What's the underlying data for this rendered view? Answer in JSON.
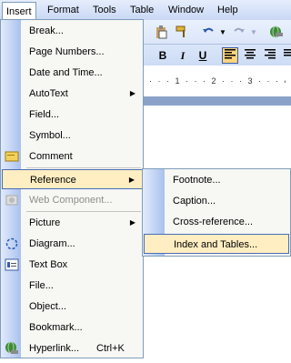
{
  "menubar": {
    "items": [
      {
        "label": "Insert",
        "active": true
      },
      {
        "label": "Format"
      },
      {
        "label": "Tools"
      },
      {
        "label": "Table"
      },
      {
        "label": "Window"
      },
      {
        "label": "Help"
      }
    ]
  },
  "insert_menu": {
    "items": [
      {
        "label": "Break...",
        "icon": null
      },
      {
        "label": "Page Numbers...",
        "icon": null
      },
      {
        "label": "Date and Time...",
        "icon": null
      },
      {
        "label": "AutoText",
        "submenu": true,
        "icon": null
      },
      {
        "label": "Field...",
        "icon": null
      },
      {
        "label": "Symbol...",
        "icon": null
      },
      {
        "label": "Comment",
        "icon": "comment-icon"
      },
      {
        "label": "Reference",
        "submenu": true,
        "highlighted": true,
        "icon": null
      },
      {
        "label": "Web Component...",
        "disabled": true,
        "icon": "web-component-icon"
      },
      {
        "label": "Picture",
        "submenu": true,
        "icon": null
      },
      {
        "label": "Diagram...",
        "icon": "diagram-icon"
      },
      {
        "label": "Text Box",
        "icon": "text-box-icon"
      },
      {
        "label": "File...",
        "icon": null
      },
      {
        "label": "Object...",
        "icon": null
      },
      {
        "label": "Bookmark...",
        "icon": null
      },
      {
        "label": "Hyperlink...",
        "shortcut": "Ctrl+K",
        "icon": "hyperlink-icon"
      }
    ],
    "expand_icon": "chevron-down-icon"
  },
  "reference_submenu": {
    "items": [
      {
        "label": "Footnote..."
      },
      {
        "label": "Caption..."
      },
      {
        "label": "Cross-reference..."
      },
      {
        "label": "Index and Tables...",
        "highlighted": true
      }
    ]
  },
  "toolbar": {
    "bold": "B",
    "italic": "I",
    "underline": "U"
  },
  "colors": {
    "highlight_fill": "#ffeec2",
    "highlight_border": "#4b6db5",
    "menu_bg": "#f7f7f4",
    "gutter": "#a9c1ee"
  }
}
